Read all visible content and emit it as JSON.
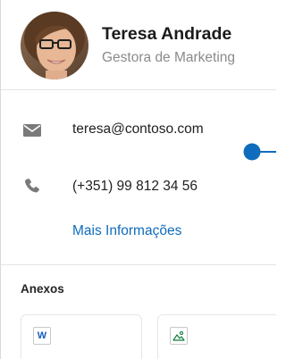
{
  "contact": {
    "name": "Teresa Andrade",
    "title": "Gestora de Marketing"
  },
  "details": {
    "email": {
      "icon": "mail-icon",
      "value": "teresa@contoso.com"
    },
    "phone": {
      "icon": "phone-icon",
      "value": "(+351) 99 812 34 56"
    },
    "more_link": "Mais Informações"
  },
  "attachments": {
    "title": "Anexos",
    "items": [
      {
        "type": "word",
        "icon": "word-file-icon",
        "letter": "W"
      },
      {
        "type": "image",
        "icon": "image-file-icon"
      }
    ]
  },
  "colors": {
    "accent": "#0f6cbd",
    "word": "#185abd",
    "image": "#107c41"
  }
}
